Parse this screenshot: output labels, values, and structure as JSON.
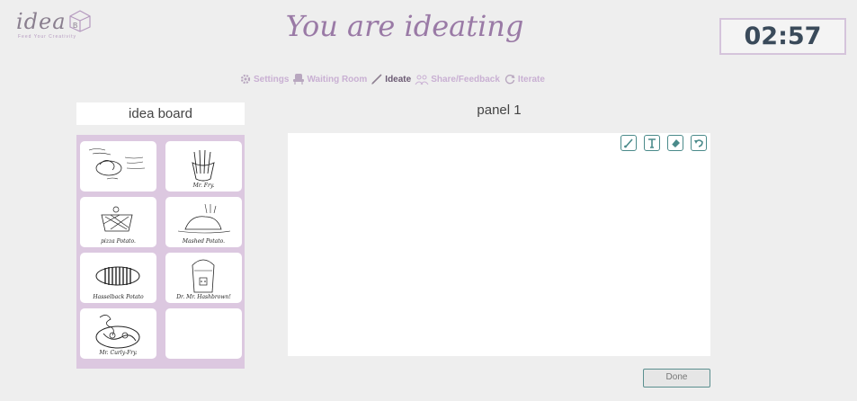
{
  "logo": {
    "word": "idea",
    "cube_letter": "B",
    "tagline": "Feed Your Creativity"
  },
  "headline": "You are ideating",
  "timer": "02:57",
  "steps": [
    {
      "label": "Settings",
      "icon": "gear-icon",
      "active": false
    },
    {
      "label": "Waiting Room",
      "icon": "chair-icon",
      "active": false
    },
    {
      "label": "Ideate",
      "icon": "pencil-icon",
      "active": true
    },
    {
      "label": "Share/Feedback",
      "icon": "people-icon",
      "active": false
    },
    {
      "label": "Iterate",
      "icon": "refresh-icon",
      "active": false
    }
  ],
  "board": {
    "title": "idea board",
    "tiles": [
      {
        "caption": ""
      },
      {
        "caption": "Mr. Fry."
      },
      {
        "caption": "pizza Potato."
      },
      {
        "caption": "Mashed Potato."
      },
      {
        "caption": "Hasselback Potato"
      },
      {
        "caption": "Dr. Mr. Hashbrown!"
      },
      {
        "caption": "Mr. Curly-Fry."
      },
      {
        "caption": ""
      }
    ]
  },
  "panel": {
    "title": "panel 1",
    "tools": [
      "brush-icon",
      "text-icon",
      "eraser-icon",
      "undo-icon"
    ]
  },
  "done_label": "Done",
  "colors": {
    "accent_purple": "#9a7aa6",
    "board_bg": "#dcc8e0",
    "teal": "#4a8a8a",
    "page_bg": "#eeeeee"
  }
}
